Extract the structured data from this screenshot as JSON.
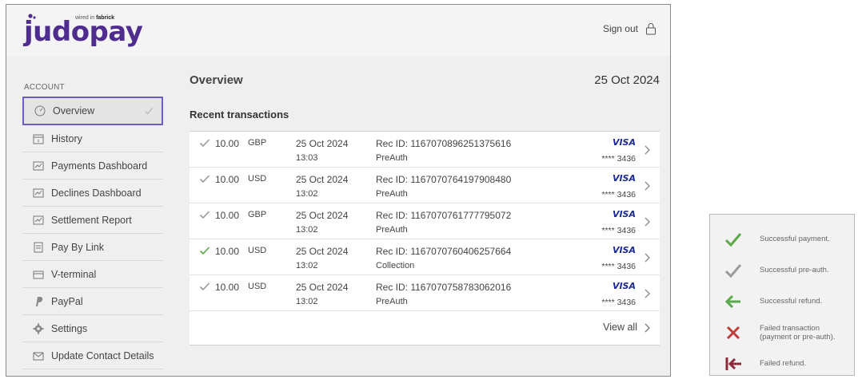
{
  "header": {
    "logo_text": "judopay",
    "logo_tagline_prefix": "wired in",
    "logo_tagline_brand": "fabrick",
    "signout_label": "Sign out"
  },
  "sidebar": {
    "section_label": "ACCOUNT",
    "items": [
      {
        "label": "Overview",
        "icon": "gauge-icon"
      },
      {
        "label": "History",
        "icon": "calendar-icon"
      },
      {
        "label": "Payments Dashboard",
        "icon": "chart-icon"
      },
      {
        "label": "Declines Dashboard",
        "icon": "chart-icon"
      },
      {
        "label": "Settlement Report",
        "icon": "chart-icon"
      },
      {
        "label": "Pay By Link",
        "icon": "document-icon"
      },
      {
        "label": "V-terminal",
        "icon": "card-icon"
      },
      {
        "label": "PayPal",
        "icon": "paypal-icon"
      },
      {
        "label": "Settings",
        "icon": "gear-icon"
      },
      {
        "label": "Update Contact Details",
        "icon": "envelope-icon"
      }
    ]
  },
  "main": {
    "title": "Overview",
    "date": "25 Oct 2024",
    "recent_title": "Recent transactions",
    "view_all_label": "View all",
    "transactions": [
      {
        "amount": "10.00",
        "currency": "GBP",
        "date": "25 Oct 2024",
        "time": "13:03",
        "rec_id": "Rec ID: 1167070896251375616",
        "type": "PreAuth",
        "brand": "VISA",
        "card": "**** 3436",
        "status": "pre-auth"
      },
      {
        "amount": "10.00",
        "currency": "USD",
        "date": "25 Oct 2024",
        "time": "13:02",
        "rec_id": "Rec ID: 1167070764197908480",
        "type": "PreAuth",
        "brand": "VISA",
        "card": "**** 3436",
        "status": "pre-auth"
      },
      {
        "amount": "10.00",
        "currency": "GBP",
        "date": "25 Oct 2024",
        "time": "13:02",
        "rec_id": "Rec ID: 1167070761777795072",
        "type": "PreAuth",
        "brand": "VISA",
        "card": "**** 3436",
        "status": "pre-auth"
      },
      {
        "amount": "10.00",
        "currency": "USD",
        "date": "25 Oct 2024",
        "time": "13:02",
        "rec_id": "Rec ID: 1167070760406257664",
        "type": "Collection",
        "brand": "VISA",
        "card": "**** 3436",
        "status": "payment"
      },
      {
        "amount": "10.00",
        "currency": "USD",
        "date": "25 Oct 2024",
        "time": "13:02",
        "rec_id": "Rec ID: 1167070758783062016",
        "type": "PreAuth",
        "brand": "VISA",
        "card": "**** 3436",
        "status": "pre-auth"
      }
    ]
  },
  "legend": {
    "items": [
      {
        "label": "Successful payment.",
        "icon": "check-green-icon"
      },
      {
        "label": "Successful pre-auth.",
        "icon": "check-grey-icon"
      },
      {
        "label": "Successful refund.",
        "icon": "arrow-left-green-icon"
      },
      {
        "label": "Failed transaction (payment or pre-auth).",
        "icon": "cross-red-icon"
      },
      {
        "label": "Failed refund.",
        "icon": "arrow-bar-left-red-icon"
      }
    ]
  },
  "colors": {
    "brand_purple": "#4f2d8f",
    "active_border": "#6f5bc7",
    "success_green": "#5aa84a",
    "neutral_grey": "#9a9a9a",
    "failed_red": "#c23a3a",
    "failed_refund": "#8c2a3c",
    "visa_blue": "#1a2a8f"
  }
}
